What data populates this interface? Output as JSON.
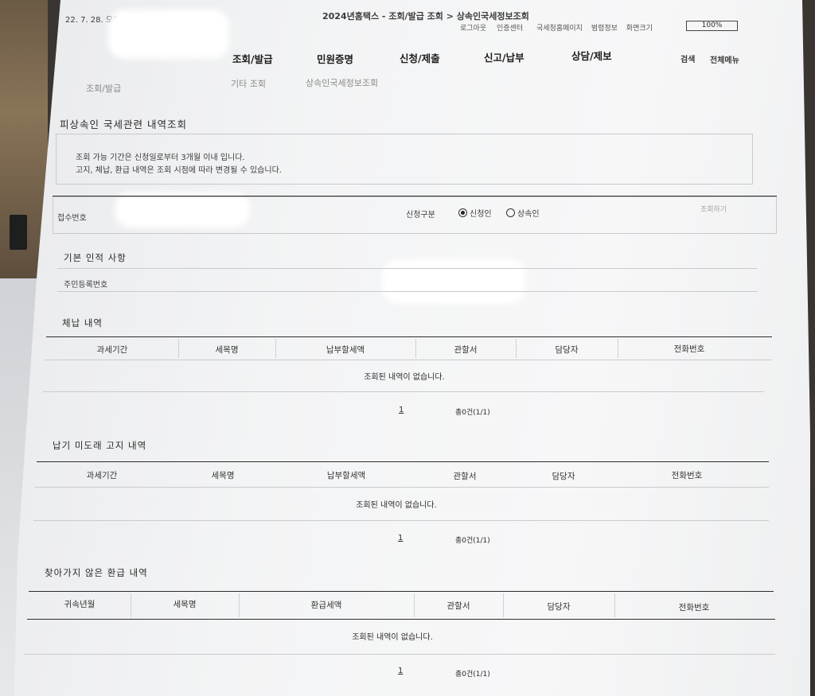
{
  "header": {
    "datetime": "22. 7. 28. 오전 8:19",
    "doc_title": "2024년홈택스 - 조회/발급 조회 > 상속인국세정보조회",
    "util_links": [
      "로그아웃",
      "인증센터",
      "국세청홈페이지",
      "범령정보",
      "화면크기"
    ],
    "zoom": "100%"
  },
  "nav": {
    "items": [
      "조회/발급",
      "민원증명",
      "신청/제출",
      "신고/납부",
      "상담/제보"
    ],
    "search": "검색",
    "menu": "전체메뉴"
  },
  "breadcrumb": [
    "조회/발급",
    "기타 조회",
    "상속인국세정보조회"
  ],
  "page_title": "피상속인 국세관련 내역조회",
  "notice": {
    "line1": "조회 가능 기간은 신청일로부터 3개월 이내 입니다.",
    "line2": "고지, 체납, 환급 내역은 조회 시점에 따라 변경될 수 있습니다."
  },
  "receipt": {
    "label": "접수번호",
    "type_label": "신청구분",
    "options": [
      "신청인",
      "상속인"
    ],
    "selected": "신청인",
    "back": "조회하기"
  },
  "basic": {
    "title": "기본 인적 사항",
    "rrn_label": "주민등록번호"
  },
  "sections": [
    {
      "title": "체납 내역",
      "headers": [
        "과세기간",
        "세목명",
        "납부할세액",
        "관할서",
        "담당자",
        "전화번호"
      ],
      "empty": "조회된 내역이 없습니다.",
      "page": "1",
      "total": "총0건(1/1)"
    },
    {
      "title": "납기 미도래 고지 내역",
      "headers": [
        "과세기간",
        "세목명",
        "납부할세액",
        "관할서",
        "담당자",
        "전화번호"
      ],
      "empty": "조회된 내역이 없습니다.",
      "page": "1",
      "total": "총0건(1/1)"
    },
    {
      "title": "찾아가지 않은 환급 내역",
      "headers": [
        "귀속년월",
        "세목명",
        "환급세액",
        "관할서",
        "담당자",
        "전화번호"
      ],
      "empty": "조회된 내역이 없습니다.",
      "page": "1",
      "total": "총0건(1/1)"
    }
  ]
}
